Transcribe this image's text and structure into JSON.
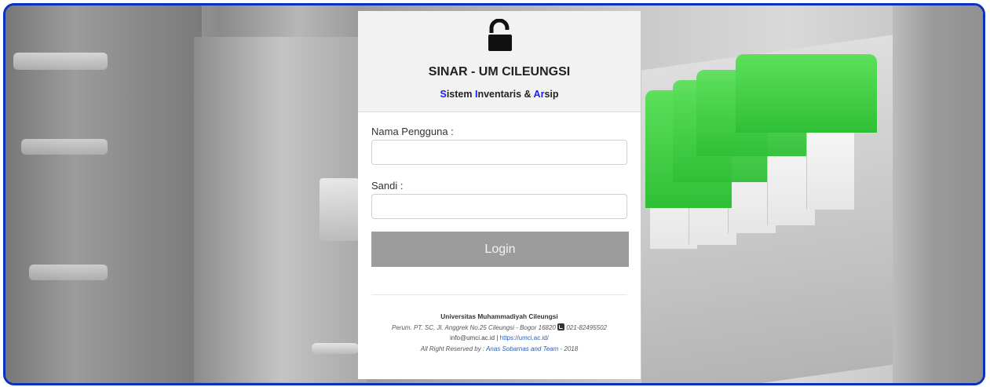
{
  "header": {
    "icon": "unlock-icon",
    "title": "SINAR - UM CILEUNGSI",
    "subtitle": {
      "s1": "S",
      "s1_rest": "istem ",
      "s2": "I",
      "s2_rest": "nventaris & ",
      "s3": "Ar",
      "s3_rest": "sip",
      "accent_color": "#1a1aff"
    }
  },
  "form": {
    "username_label": "Nama Pengguna :",
    "username_value": "",
    "password_label": "Sandi :",
    "password_value": "",
    "login_label": "Login"
  },
  "footer": {
    "org": "Universitas Muhammadiyah Cileungsi",
    "address": "Perum. PT. SC, Jl. Anggrek No.25 Cileungsi - Bogor 16820",
    "phone_icon": "phone-icon",
    "phone": "021-82495502",
    "email": "info@umci.ac.id",
    "separator": " | ",
    "website": "https://umci.ac.id/",
    "rights_prefix": "All Right Reserved by : ",
    "rights_author": "Anas Sobarnas and Team",
    "rights_year": " - 2018"
  },
  "colors": {
    "frame_border": "#0d2fbf",
    "button_bg": "#9c9c9c",
    "link": "#2d5fb3"
  }
}
